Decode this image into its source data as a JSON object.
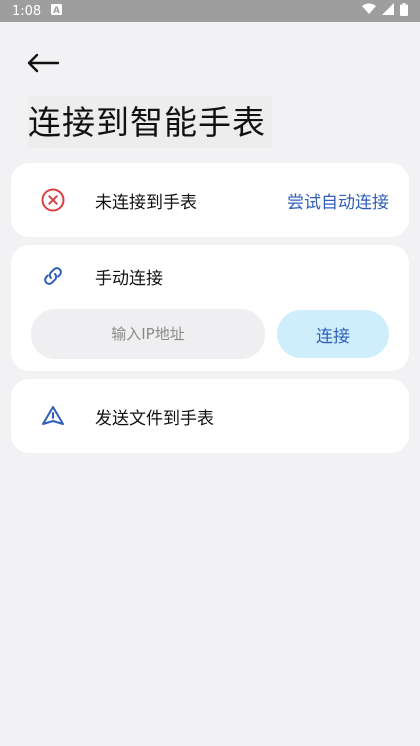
{
  "status_bar": {
    "time": "1:08",
    "icons": [
      "notification-a-icon",
      "wifi-icon",
      "signal-icon",
      "battery-icon"
    ]
  },
  "header": {
    "back_icon": "arrow-left-icon",
    "title": "连接到智能手表"
  },
  "connection_status": {
    "icon": "error-circle-icon",
    "label": "未连接到手表",
    "action_label": "尝试自动连接"
  },
  "manual_connect": {
    "icon": "link-icon",
    "label": "手动连接",
    "ip_placeholder": "输入IP地址",
    "ip_value": "",
    "connect_label": "连接"
  },
  "send_files": {
    "icon": "send-warning-icon",
    "label": "发送文件到手表"
  },
  "colors": {
    "accent": "#2f5fb8",
    "error": "#d94040",
    "connect_button_bg": "#cfeefb",
    "background": "#f2f2f4"
  }
}
